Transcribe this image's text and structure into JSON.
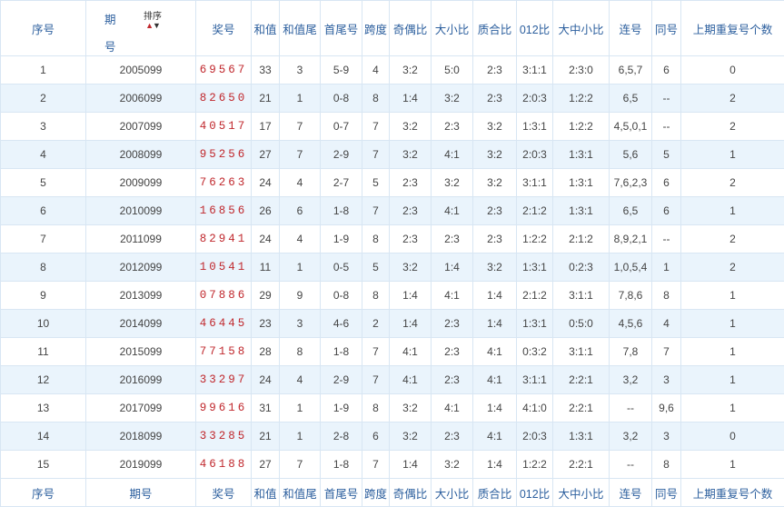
{
  "headers": [
    "序号",
    "期号",
    "奖号",
    "和值",
    "和值尾",
    "首尾号",
    "跨度",
    "奇偶比",
    "大小比",
    "质合比",
    "012比",
    "大中小比",
    "连号",
    "同号",
    "上期重复号个数"
  ],
  "period_header": {
    "line1": "期",
    "line2": "号",
    "sort_label": "排序",
    "sort_up": "▲",
    "sort_down": "▼"
  },
  "rows": [
    [
      "1",
      "2005099",
      "69567",
      "33",
      "3",
      "5-9",
      "4",
      "3:2",
      "5:0",
      "2:3",
      "3:1:1",
      "2:3:0",
      "6,5,7",
      "6",
      "0"
    ],
    [
      "2",
      "2006099",
      "82650",
      "21",
      "1",
      "0-8",
      "8",
      "1:4",
      "3:2",
      "2:3",
      "2:0:3",
      "1:2:2",
      "6,5",
      "--",
      "2"
    ],
    [
      "3",
      "2007099",
      "40517",
      "17",
      "7",
      "0-7",
      "7",
      "3:2",
      "2:3",
      "3:2",
      "1:3:1",
      "1:2:2",
      "4,5,0,1",
      "--",
      "2"
    ],
    [
      "4",
      "2008099",
      "95256",
      "27",
      "7",
      "2-9",
      "7",
      "3:2",
      "4:1",
      "3:2",
      "2:0:3",
      "1:3:1",
      "5,6",
      "5",
      "1"
    ],
    [
      "5",
      "2009099",
      "76263",
      "24",
      "4",
      "2-7",
      "5",
      "2:3",
      "3:2",
      "3:2",
      "3:1:1",
      "1:3:1",
      "7,6,2,3",
      "6",
      "2"
    ],
    [
      "6",
      "2010099",
      "16856",
      "26",
      "6",
      "1-8",
      "7",
      "2:3",
      "4:1",
      "2:3",
      "2:1:2",
      "1:3:1",
      "6,5",
      "6",
      "1"
    ],
    [
      "7",
      "2011099",
      "82941",
      "24",
      "4",
      "1-9",
      "8",
      "2:3",
      "2:3",
      "2:3",
      "1:2:2",
      "2:1:2",
      "8,9,2,1",
      "--",
      "2"
    ],
    [
      "8",
      "2012099",
      "10541",
      "11",
      "1",
      "0-5",
      "5",
      "3:2",
      "1:4",
      "3:2",
      "1:3:1",
      "0:2:3",
      "1,0,5,4",
      "1",
      "2"
    ],
    [
      "9",
      "2013099",
      "07886",
      "29",
      "9",
      "0-8",
      "8",
      "1:4",
      "4:1",
      "1:4",
      "2:1:2",
      "3:1:1",
      "7,8,6",
      "8",
      "1"
    ],
    [
      "10",
      "2014099",
      "46445",
      "23",
      "3",
      "4-6",
      "2",
      "1:4",
      "2:3",
      "1:4",
      "1:3:1",
      "0:5:0",
      "4,5,6",
      "4",
      "1"
    ],
    [
      "11",
      "2015099",
      "77158",
      "28",
      "8",
      "1-8",
      "7",
      "4:1",
      "2:3",
      "4:1",
      "0:3:2",
      "3:1:1",
      "7,8",
      "7",
      "1"
    ],
    [
      "12",
      "2016099",
      "33297",
      "24",
      "4",
      "2-9",
      "7",
      "4:1",
      "2:3",
      "4:1",
      "3:1:1",
      "2:2:1",
      "3,2",
      "3",
      "1"
    ],
    [
      "13",
      "2017099",
      "99616",
      "31",
      "1",
      "1-9",
      "8",
      "3:2",
      "4:1",
      "1:4",
      "4:1:0",
      "2:2:1",
      "--",
      "9,6",
      "1"
    ],
    [
      "14",
      "2018099",
      "33285",
      "21",
      "1",
      "2-8",
      "6",
      "3:2",
      "2:3",
      "4:1",
      "2:0:3",
      "1:3:1",
      "3,2",
      "3",
      "0"
    ],
    [
      "15",
      "2019099",
      "46188",
      "27",
      "7",
      "1-8",
      "7",
      "1:4",
      "3:2",
      "1:4",
      "1:2:2",
      "2:2:1",
      "--",
      "8",
      "1"
    ]
  ],
  "footer": [
    "序号",
    "期号",
    "奖号",
    "和值",
    "和值尾",
    "首尾号",
    "跨度",
    "奇偶比",
    "大小比",
    "质合比",
    "012比",
    "大中小比",
    "连号",
    "同号",
    "上期重复号个数"
  ]
}
